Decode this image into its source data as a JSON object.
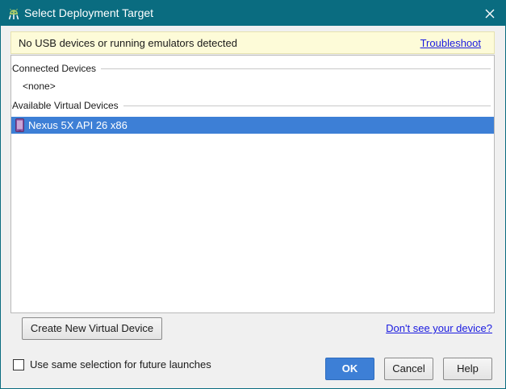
{
  "window": {
    "title": "Select Deployment Target",
    "icon": "android-studio-icon",
    "close_icon": "close-icon",
    "titlebar_color": "#0a6c80"
  },
  "banner": {
    "message": "No USB devices or running emulators detected",
    "link": "Troubleshoot",
    "background": "#fdfbd8"
  },
  "device_list": {
    "connected_header": "Connected Devices",
    "connected_empty": "<none>",
    "available_header": "Available Virtual Devices",
    "devices": [
      {
        "name": "Nexus 5X API 26 x86",
        "icon": "phone-device-icon",
        "selected": true
      }
    ],
    "selection_color": "#3d7fd6"
  },
  "actions": {
    "create_button": "Create New Virtual Device",
    "help_link": "Don't see your device?"
  },
  "footer": {
    "checkbox_label": "Use same selection for future launches",
    "checkbox_checked": false,
    "ok_label": "OK",
    "cancel_label": "Cancel",
    "help_label": "Help"
  }
}
